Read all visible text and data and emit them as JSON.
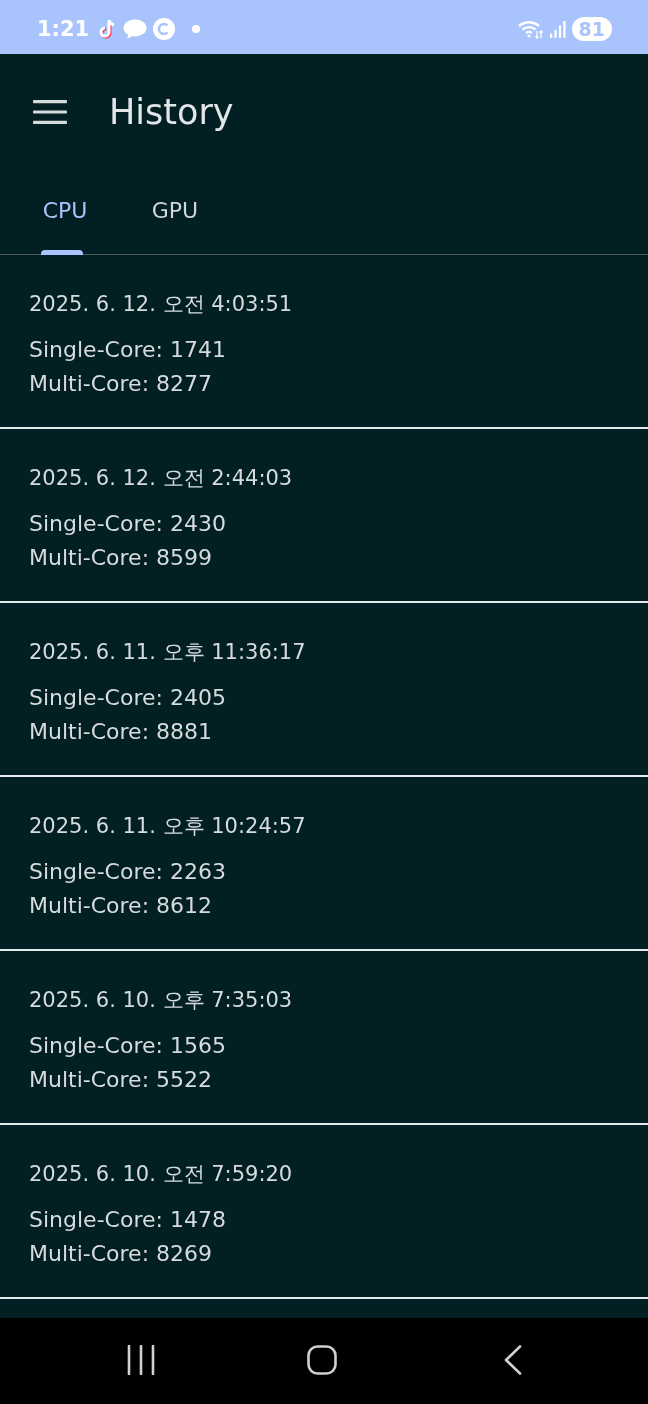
{
  "status_bar": {
    "time": "1:21",
    "battery": "81"
  },
  "app_bar": {
    "title": "History"
  },
  "tabs": [
    {
      "label": "CPU",
      "selected": true
    },
    {
      "label": "GPU",
      "selected": false
    }
  ],
  "history": [
    {
      "date": "2025. 6. 12. 오전 4:03:51",
      "single_core": "Single-Core: 1741",
      "multi_core": "Multi-Core: 8277"
    },
    {
      "date": "2025. 6. 12. 오전 2:44:03",
      "single_core": "Single-Core: 2430",
      "multi_core": "Multi-Core: 8599"
    },
    {
      "date": "2025. 6. 11. 오후 11:36:17",
      "single_core": "Single-Core: 2405",
      "multi_core": "Multi-Core: 8881"
    },
    {
      "date": "2025. 6. 11. 오후 10:24:57",
      "single_core": "Single-Core: 2263",
      "multi_core": "Multi-Core: 8612"
    },
    {
      "date": "2025. 6. 10. 오후 7:35:03",
      "single_core": "Single-Core: 1565",
      "multi_core": "Multi-Core: 5522"
    },
    {
      "date": "2025. 6. 10. 오전 7:59:20",
      "single_core": "Single-Core: 1478",
      "multi_core": "Multi-Core: 8269"
    }
  ]
}
